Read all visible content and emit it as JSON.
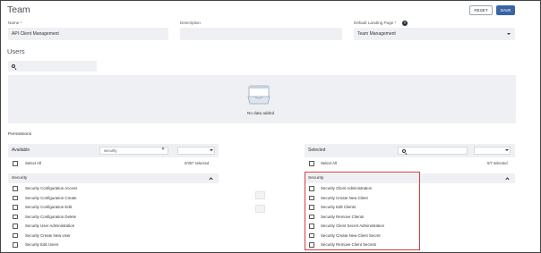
{
  "header": {
    "title": "Team",
    "reset_label": "RESET",
    "save_label": "SAVE"
  },
  "form": {
    "name_label": "Name",
    "required_mark": "*",
    "name_value": "API Client Management",
    "description_label": "Description",
    "description_value": "",
    "landing_label": "Default Landing Page",
    "landing_value": "Team Management"
  },
  "users": {
    "title": "Users",
    "search_placeholder": "",
    "empty_text": "No data added"
  },
  "permissions": {
    "title": "Permissions",
    "available": {
      "header": "Available",
      "search_value": "security",
      "select_all_label": "Select All",
      "count_text": "0/357 selected",
      "group_label": "Security",
      "items": [
        "Security Configuration Access",
        "Security Configuration Create",
        "Security Configuration Edit",
        "Security Configuration Delete",
        "Security User Administration",
        "Security Create New User",
        "Security Edit Users"
      ]
    },
    "selected": {
      "header": "Selected",
      "search_value": "",
      "select_all_label": "Select All",
      "count_text": "0/7 selected",
      "group_label": "Security",
      "items": [
        "Security Client Administration",
        "Security Create New Client",
        "Security Edit Clients",
        "Security Remove Clients",
        "Security Client Secret Administration",
        "Security Create New Client Secret",
        "Security Remove Client Secrets"
      ]
    }
  },
  "icons": {
    "help": "help-icon",
    "search": "search-icon",
    "clear": "close-icon",
    "dropdown": "chevron-down-icon",
    "collapse": "chevron-up-icon",
    "empty": "empty-tray-icon"
  },
  "colors": {
    "accent": "#3a64a4",
    "panel_bg": "#eef0f3",
    "highlight": "#d93a3a"
  }
}
